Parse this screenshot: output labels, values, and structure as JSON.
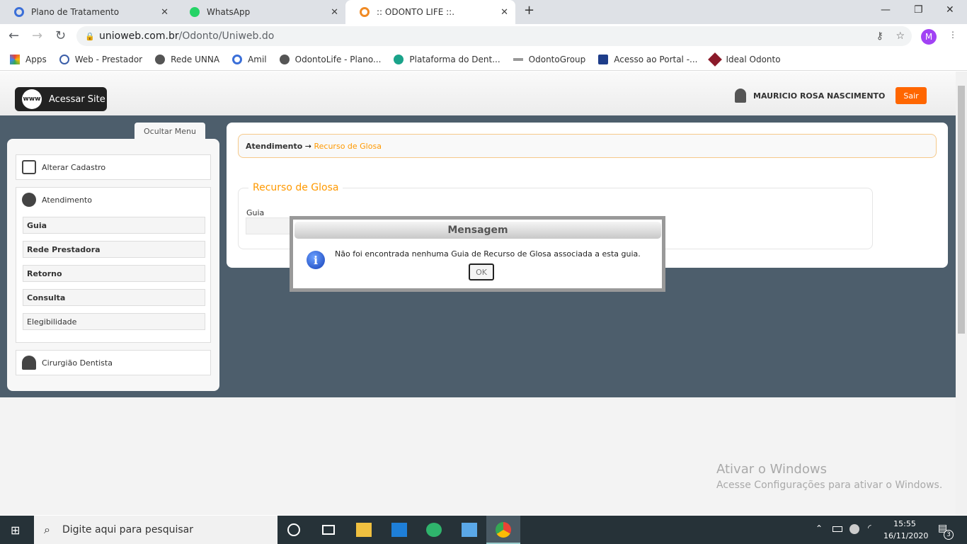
{
  "browser": {
    "tabs": [
      {
        "title": "Plano de Tratamento"
      },
      {
        "title": "WhatsApp"
      },
      {
        "title": ":: ODONTO LIFE ::."
      }
    ],
    "url_host": "unioweb.com.br",
    "url_path": "/Odonto/Uniweb.do",
    "profile_initial": "M",
    "bookmarks": [
      "Apps",
      "Web - Prestador",
      "Rede UNNA",
      "Amil",
      "OdontoLife - Plano...",
      "Plataforma do Dent...",
      "OdontoGroup",
      "Acesso ao Portal -...",
      "Ideal Odonto"
    ]
  },
  "header": {
    "site_button": "Acessar Site",
    "www": "www",
    "user": "MAURICIO ROSA NASCIMENTO",
    "logout": "Sair"
  },
  "sidebar": {
    "hide_menu": "Ocultar Menu",
    "alterar": "Alterar Cadastro",
    "atendimento": "Atendimento",
    "items": [
      "Guia",
      "Rede Prestadora",
      "Retorno",
      "Consulta",
      "Elegibilidade"
    ],
    "cirurgiao": "Cirurgião Dentista"
  },
  "main": {
    "breadcrumb_parent": "Atendimento",
    "breadcrumb_arrow": " → ",
    "breadcrumb_current": "Recurso de Glosa",
    "section_title": "Recurso de Glosa",
    "guia_label": "Guia"
  },
  "dialog": {
    "title": "Mensagem",
    "message": "Não foi encontrada nenhuma Guia de Recurso de Glosa associada a esta guia.",
    "ok": "OK"
  },
  "watermark": {
    "line1": "Ativar o Windows",
    "line2": "Acesse Configurações para ativar o Windows."
  },
  "taskbar": {
    "search_placeholder": "Digite aqui para pesquisar",
    "time": "15:55",
    "date": "16/11/2020",
    "notifications": "3"
  }
}
